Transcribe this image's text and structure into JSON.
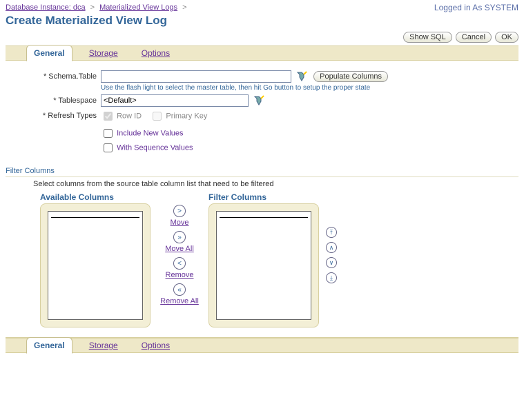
{
  "breadcrumb": {
    "items": [
      {
        "label": "Database Instance: dca"
      },
      {
        "label": "Materialized View Logs"
      }
    ],
    "sep": ">"
  },
  "logged_in": "Logged in As SYSTEM",
  "page_title": "Create Materialized View Log",
  "actions": {
    "show_sql": "Show SQL",
    "cancel": "Cancel",
    "ok": "OK"
  },
  "tabs": {
    "general": "General",
    "storage": "Storage",
    "options": "Options"
  },
  "form": {
    "schema_table": {
      "label": "Schema.Table",
      "value": "",
      "populate": "Populate Columns",
      "hint": "Use the flash light to select the master table, then hit Go button to setup the proper state"
    },
    "tablespace": {
      "label": "Tablespace",
      "value": "<Default>"
    },
    "refresh": {
      "label": "Refresh Types",
      "row_id": "Row ID",
      "primary_key": "Primary Key",
      "include_new": "Include New Values",
      "with_sequence": "With Sequence Values"
    }
  },
  "filter": {
    "heading": "Filter Columns",
    "desc": "Select columns from the source table column list that need to be filtered",
    "available_title": "Available Columns",
    "filter_title": "Filter Columns",
    "move": "Move",
    "move_all": "Move All",
    "remove": "Remove",
    "remove_all": "Remove All"
  }
}
